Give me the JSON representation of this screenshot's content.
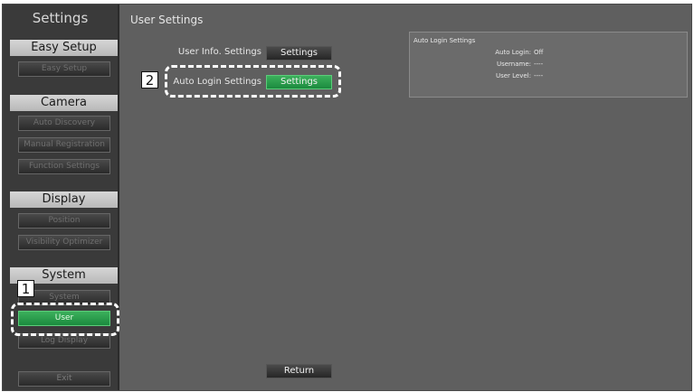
{
  "sidebar": {
    "title": "Settings",
    "sections": [
      {
        "header": "Easy Setup",
        "items": [
          "Easy Setup"
        ]
      },
      {
        "header": "Camera",
        "items": [
          "Auto Discovery",
          "Manual Registration",
          "Function Settings"
        ]
      },
      {
        "header": "Display",
        "items": [
          "Position",
          "Visibility Optimizer"
        ]
      },
      {
        "header": "System",
        "items": [
          "System",
          "User",
          "Log Display"
        ]
      }
    ],
    "exit_label": "Exit",
    "active_item": "User"
  },
  "main": {
    "title": "User Settings",
    "rows": [
      {
        "label": "User Info. Settings",
        "button": "Settings"
      },
      {
        "label": "Auto Login Settings",
        "button": "Settings"
      }
    ],
    "return_label": "Return"
  },
  "info_panel": {
    "title": "Auto Login Settings",
    "fields": [
      {
        "key": "Auto Login:",
        "value": "Off"
      },
      {
        "key": "Username:",
        "value": "----"
      },
      {
        "key": "User Level:",
        "value": "----"
      }
    ]
  },
  "callouts": [
    "1",
    "2"
  ],
  "colors": {
    "active_green": "#2a9e4c",
    "background": "#5f5f5f",
    "sidebar": "#3a3a3a"
  }
}
